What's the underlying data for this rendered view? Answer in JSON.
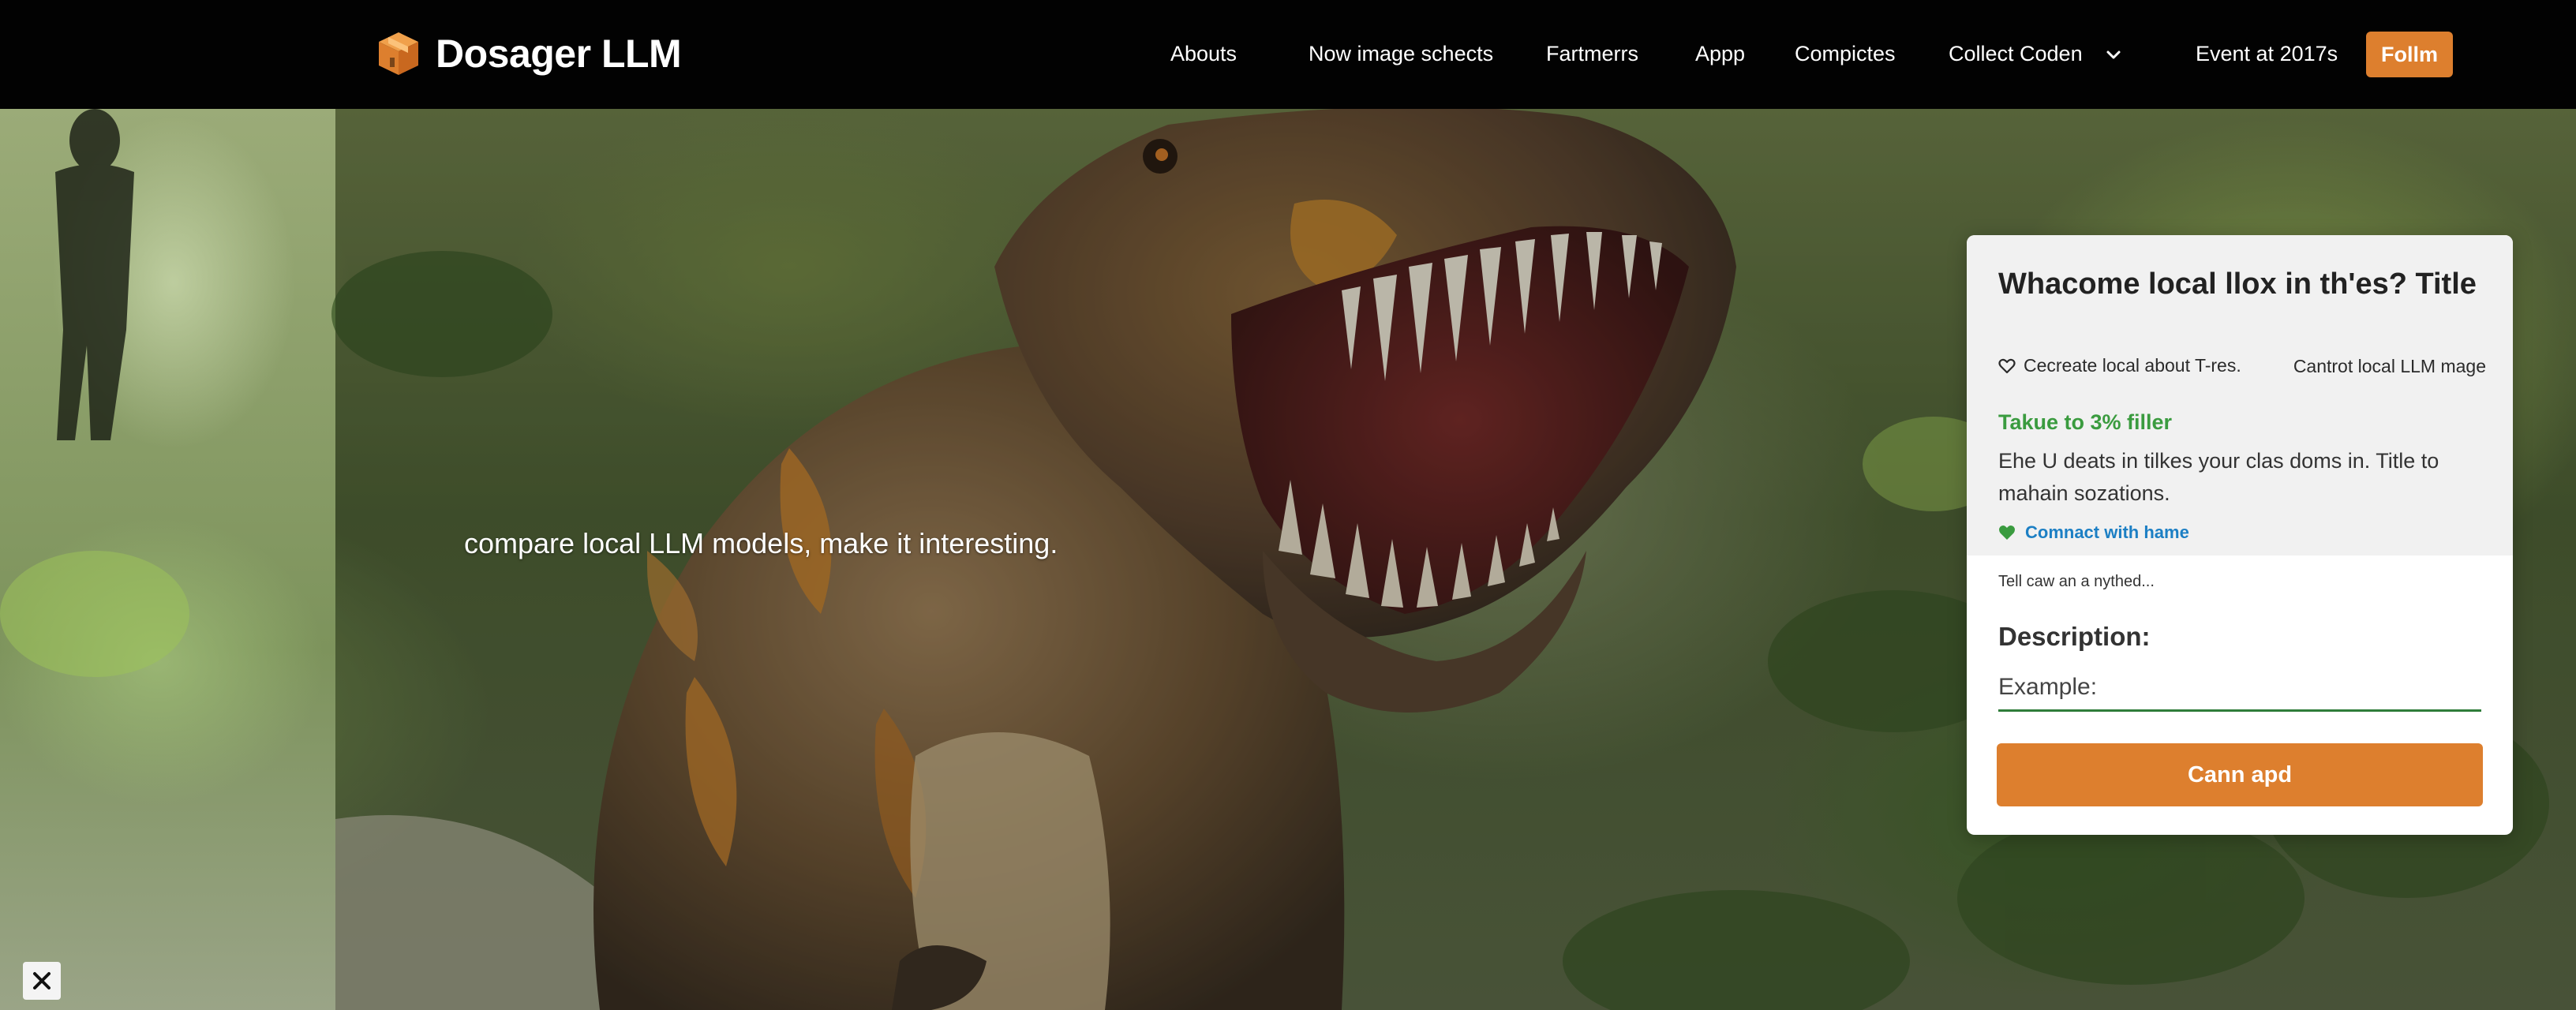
{
  "brand": {
    "name": "Dosager LLM",
    "logo_icon": "box-logo-icon",
    "accent": "#dd7f2e"
  },
  "nav": {
    "items": [
      {
        "label": "Abouts"
      },
      {
        "label": "Now image schects"
      },
      {
        "label": "Fartmerrs"
      },
      {
        "label": "Appp"
      },
      {
        "label": "Compictes"
      },
      {
        "label": "Collect Coden"
      },
      {
        "label": "Event at 2017s"
      }
    ],
    "dropdown_icon": "chevron-down-icon",
    "follow_label": "Follm"
  },
  "hero": {
    "tagline": "compare local LLM models, make it interesting."
  },
  "card": {
    "title": "Whacome local llox in th'es? Title",
    "meta_left": "Cecreate local about T-res.",
    "meta_left_icon": "heart-outline-icon",
    "meta_right": "Cantrot local LLM mage",
    "promo_title": "Takue to 3% filler",
    "promo_color": "#3a9b3f",
    "promo_body": "Ehe U deats in tilkes your clas doms in. Title to mahain sozations.",
    "contact_label": "Comnact with hame",
    "contact_icon": "heart-filled-icon",
    "contact_color": "#1c7fc4",
    "note": "Tell caw an a nythed...",
    "description_label": "Description:",
    "input_placeholder": "Example:",
    "input_value": "",
    "submit_label": "Cann apd"
  },
  "close_icon": "close-icon"
}
